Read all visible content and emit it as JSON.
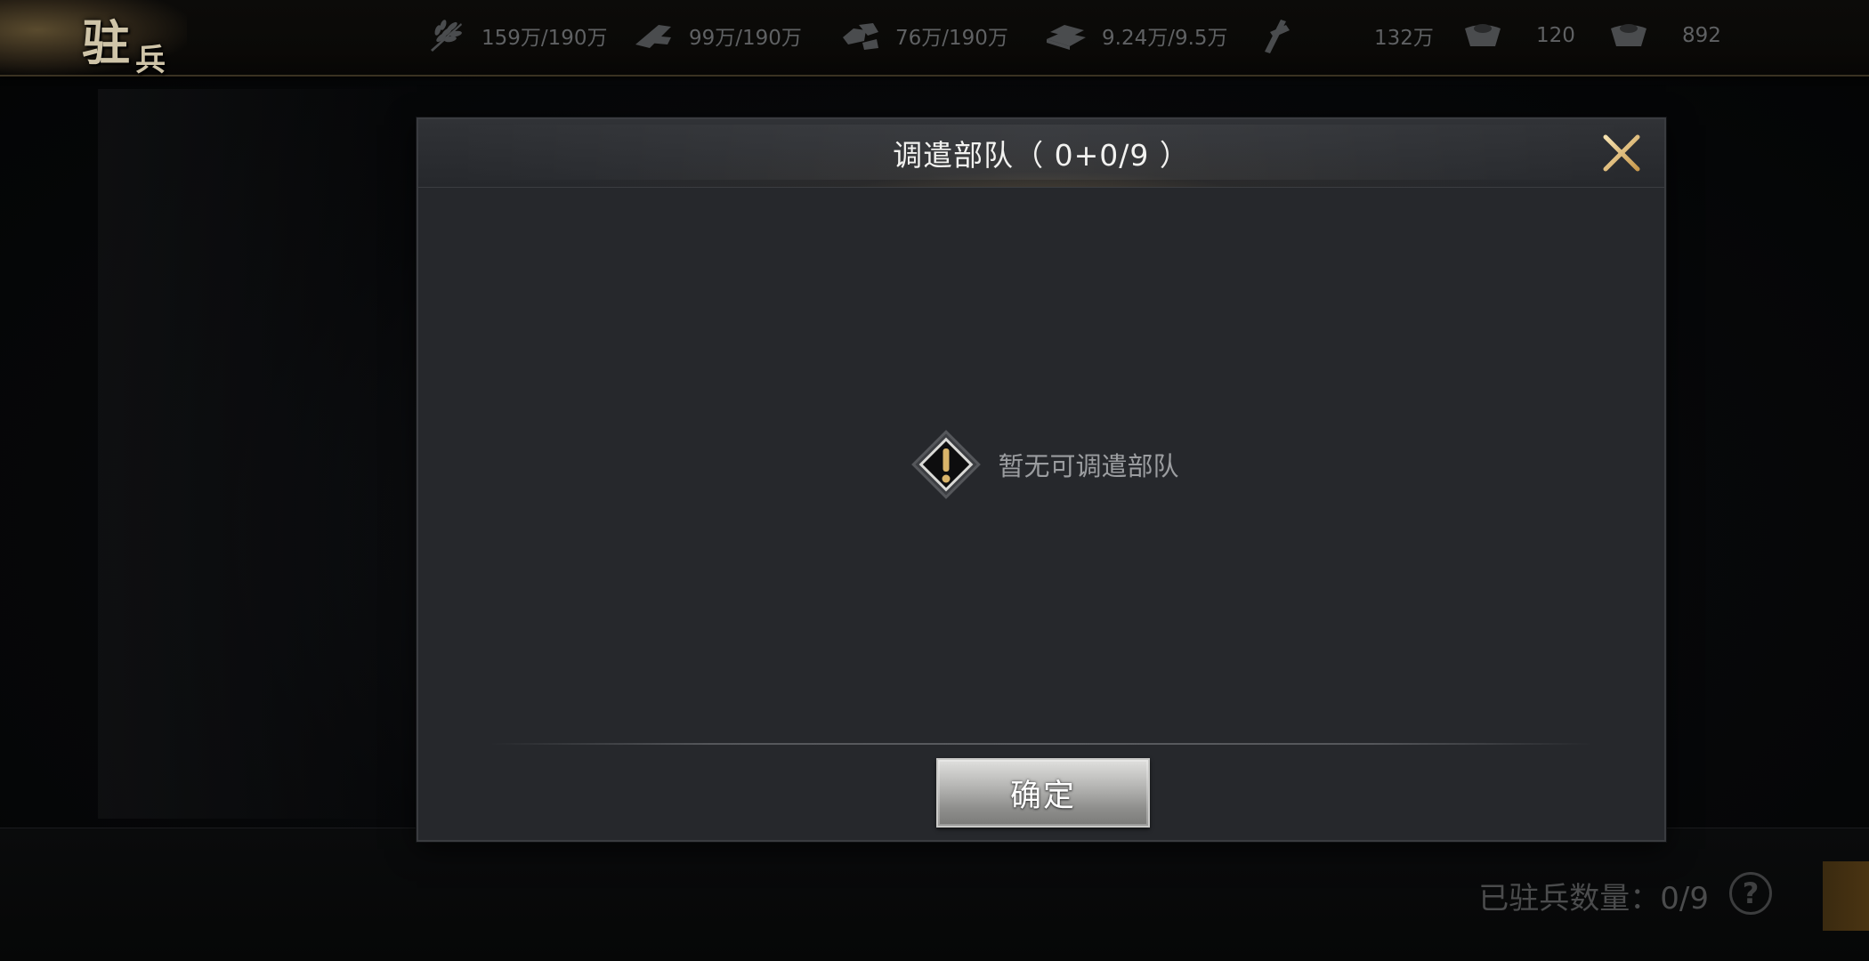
{
  "page": {
    "title_char_1": "驻",
    "title_char_2": "兵"
  },
  "resources": [
    {
      "icon": "wheat-icon",
      "value": "159万/190万"
    },
    {
      "icon": "wood-icon",
      "value": "99万/190万"
    },
    {
      "icon": "stone-icon",
      "value": "76万/190万"
    },
    {
      "icon": "iron-icon",
      "value": "9.24万/9.5万"
    },
    {
      "icon": "copper-coin-icon",
      "value": "132万"
    },
    {
      "icon": "silver-ingot-icon",
      "value": "120"
    },
    {
      "icon": "gold-ingot-icon",
      "value": "892"
    }
  ],
  "dialog": {
    "title": "调遣部队（ 0+0/9 ）",
    "empty_message": "暂无可调遣部队",
    "confirm_label": "确定"
  },
  "footer": {
    "garrison_count": "已驻兵数量：0/9",
    "help_label": "?"
  },
  "colors": {
    "dialog_bg": "#26282c",
    "gold_accent": "#d9b46a",
    "resource_text": "#5f6163"
  }
}
